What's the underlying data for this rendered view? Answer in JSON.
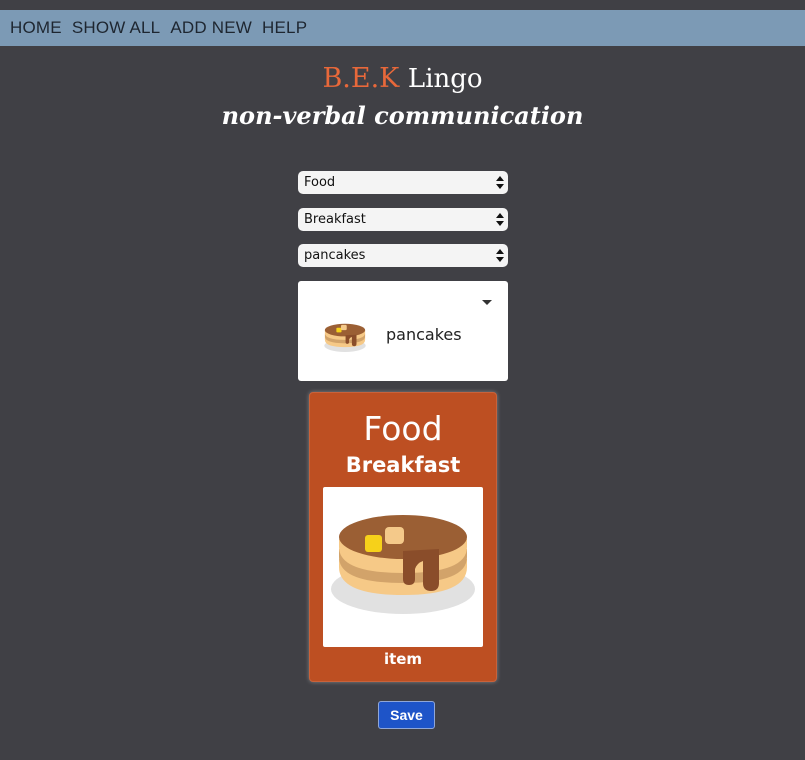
{
  "nav": {
    "items": [
      "HOME",
      "SHOW ALL",
      "ADD NEW",
      "HELP"
    ]
  },
  "brand": {
    "name": "B.E.K",
    "suffix": "Lingo",
    "tagline": "non-verbal communication"
  },
  "selects": {
    "category": "Food",
    "subcategory": "Breakfast",
    "item": "pancakes"
  },
  "preview": {
    "label": "pancakes",
    "icon": "pancakes-icon"
  },
  "card": {
    "category": "Food",
    "subcategory": "Breakfast",
    "caption": "item",
    "icon": "pancakes-icon"
  },
  "actions": {
    "save_label": "Save"
  },
  "colors": {
    "background": "#404045",
    "navbar": "#7c9ab5",
    "brand_accent": "#e8683a",
    "card": "#bd4f22",
    "save_button": "#1e54c8"
  }
}
